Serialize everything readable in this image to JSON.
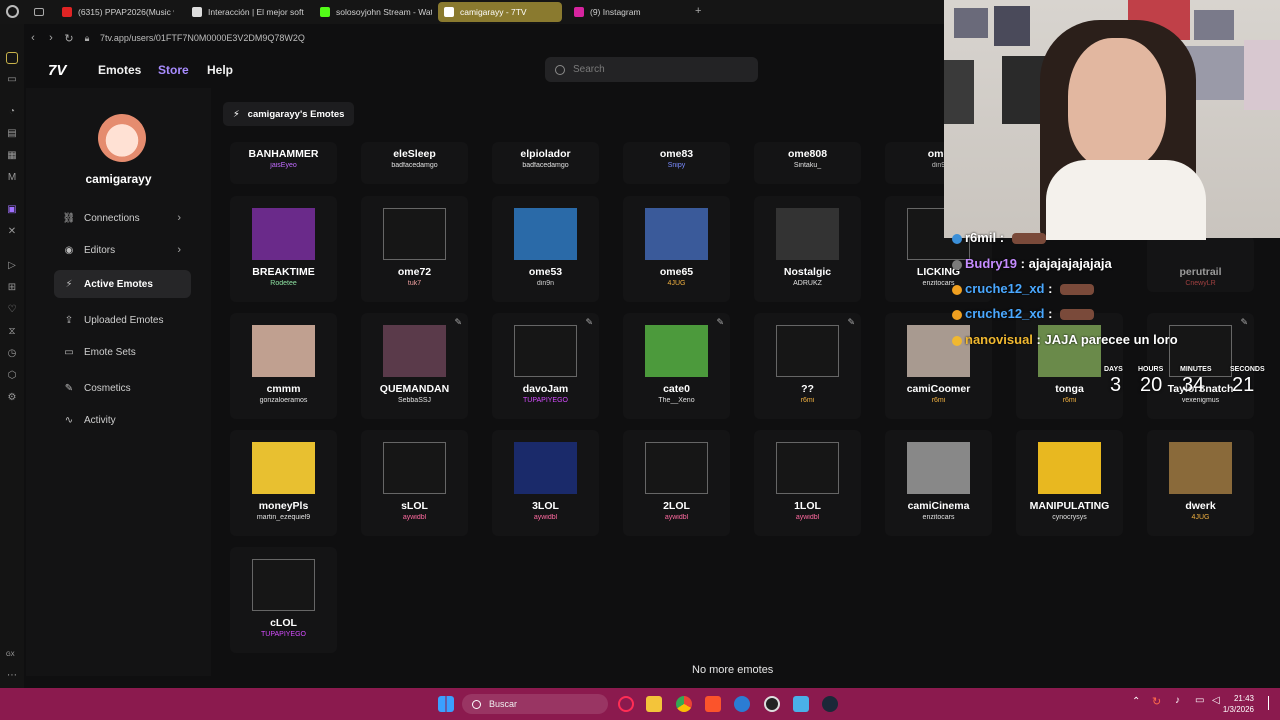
{
  "browser": {
    "tabs": [
      {
        "label": "(6315) PPAP2026(Music v",
        "color": "#e02424",
        "active": false
      },
      {
        "label": "Interacción | El mejor soft",
        "color": "#dddddd",
        "active": false
      },
      {
        "label": "solosoyjohn Stream - Wat",
        "color": "#53fc18",
        "active": false
      },
      {
        "label": "camigarayy - 7TV",
        "color": "#ffffff",
        "active": true
      },
      {
        "label": "(9) Instagram",
        "color": "#d6249f",
        "active": false
      }
    ],
    "url": "7tv.app/users/01FTF7N0M0000E3V2DM9Q78W2Q"
  },
  "header": {
    "logo": "7V",
    "nav": [
      "Emotes",
      "Store",
      "Help"
    ],
    "store_color": "#a88cff",
    "search_placeholder": "Search"
  },
  "sidebar": {
    "username": "camigarayy",
    "items": [
      {
        "label": "Connections",
        "icon": "link-icon",
        "glyph": "⛓",
        "chevron": true,
        "active": false
      },
      {
        "label": "Editors",
        "icon": "user-circle-icon",
        "glyph": "◉",
        "chevron": true,
        "active": false
      },
      {
        "label": "Active Emotes",
        "icon": "bolt-icon",
        "glyph": "⚡",
        "chevron": false,
        "active": true
      },
      {
        "label": "Uploaded Emotes",
        "icon": "upload-icon",
        "glyph": "⇪",
        "chevron": false,
        "active": false
      },
      {
        "label": "Emote Sets",
        "icon": "folder-icon",
        "glyph": "▭",
        "chevron": false,
        "active": false
      },
      {
        "label": "Cosmetics",
        "icon": "brush-icon",
        "glyph": "✎",
        "chevron": false,
        "active": false
      },
      {
        "label": "Activity",
        "icon": "activity-icon",
        "glyph": "∿",
        "chevron": false,
        "active": false
      }
    ]
  },
  "content": {
    "title": "camigarayy's Emotes",
    "footer": "No more emotes",
    "rows": [
      [
        {
          "name": "BANHAMMER",
          "owner": "jaisEyeo",
          "ownerColor": "#c26cff"
        },
        {
          "name": "eleSleep",
          "owner": "badfacedamgo",
          "ownerColor": "#e0e0e0"
        },
        {
          "name": "elpiolador",
          "owner": "badfacedamgo",
          "ownerColor": "#e0e0e0"
        },
        {
          "name": "ome83",
          "owner": "Snipy",
          "ownerColor": "#7a8cff"
        },
        {
          "name": "ome808",
          "owner": "Sintaku_",
          "ownerColor": "#e0e0e0"
        },
        {
          "name": "ome",
          "owner": "din9",
          "ownerColor": "#bbbbbb"
        }
      ],
      [
        {
          "name": "BREAKTIME",
          "owner": "Rodetee",
          "ownerColor": "#8ce0a0",
          "pic": "#6a2a8a"
        },
        {
          "name": "ome72",
          "owner": "tuk7",
          "ownerColor": "#f0a0a0"
        },
        {
          "name": "ome53",
          "owner": "din9n",
          "ownerColor": "#d0d0d0",
          "pic": "#2a6aa8"
        },
        {
          "name": "ome65",
          "owner": "4JUG",
          "ownerColor": "#f0b040",
          "pic": "#3a5a9a"
        },
        {
          "name": "Nostalgic",
          "owner": "ADRUKZ",
          "ownerColor": "#e0e0e0",
          "pic": "#333333"
        },
        {
          "name": "LICKING",
          "owner": "enzitocars",
          "ownerColor": "#e0e0e0"
        }
      ],
      [
        {
          "name": "cmmm",
          "owner": "gonzaloeramos",
          "ownerColor": "#e0e0e0",
          "pic": "#c0a090"
        },
        {
          "name": "QUEMANDAN",
          "owner": "SebbaSSJ",
          "ownerColor": "#e0e0e0",
          "pic": "#5a3a4a",
          "edit": true
        },
        {
          "name": "davoJam",
          "owner": "TUPAPIYEGO",
          "ownerColor": "#d54cff",
          "edit": true
        },
        {
          "name": "cate0",
          "owner": "The__Xeno",
          "ownerColor": "#e0e0e0",
          "pic": "#4c9a3c",
          "edit": true
        },
        {
          "name": "??",
          "owner": "r6mi",
          "ownerColor": "#f0b040",
          "edit": true
        },
        {
          "name": "camiCoomer",
          "owner": "r6mi",
          "ownerColor": "#f0b040",
          "pic": "#a89a90"
        },
        {
          "name": "tonga",
          "owner": "r6mi",
          "ownerColor": "#f0b040",
          "pic": "#6a8a4a"
        },
        {
          "name": "TaylorSnatch",
          "owner": "vexenigmus",
          "ownerColor": "#e0e0e0",
          "edit": true
        }
      ],
      [
        {
          "name": "moneyPls",
          "owner": "martin_ezequiel9",
          "ownerColor": "#e0e0e0",
          "pic": "#e8c030"
        },
        {
          "name": "sLOL",
          "owner": "aywidbl",
          "ownerColor": "#ff6aa0"
        },
        {
          "name": "3LOL",
          "owner": "aywidbl",
          "ownerColor": "#ff6aa0",
          "pic": "#1a2a6a"
        },
        {
          "name": "2LOL",
          "owner": "aywidbl",
          "ownerColor": "#ff6aa0"
        },
        {
          "name": "1LOL",
          "owner": "aywidbl",
          "ownerColor": "#ff6aa0"
        },
        {
          "name": "camiCinema",
          "owner": "enzitocars",
          "ownerColor": "#e0e0e0",
          "pic": "#888888"
        },
        {
          "name": "MANIPULATING",
          "owner": "cynocrysys",
          "ownerColor": "#e0e0e0",
          "pic": "#e8b820"
        },
        {
          "name": "dwerk",
          "owner": "4JUG",
          "ownerColor": "#f0b040",
          "pic": "#8a6a3a"
        }
      ],
      [
        {
          "name": "cLOL",
          "owner": "TUPAPIYEGO",
          "ownerColor": "#d54cff"
        }
      ]
    ]
  },
  "overlay": {
    "chat": [
      {
        "user": "r6mil",
        "userColor": "#ffffff",
        "message": "",
        "badge": "#3b8fd8"
      },
      {
        "user": "Budry19",
        "userColor": "#c58cff",
        "message": "ajajajajajajaja",
        "badge": "#7a7a7a"
      },
      {
        "user": "cruche12_xd",
        "userColor": "#4aa8ff",
        "message": "",
        "badge": "#f0a020"
      },
      {
        "user": "cruche12_xd",
        "userColor": "#4aa8ff",
        "message": "",
        "badge": "#f0a020"
      },
      {
        "user": "nanovisual",
        "userColor": "#f0b830",
        "message": "JAJA parecee un loro",
        "badge": "#f0b830"
      }
    ],
    "partial_name": "perutrail",
    "partial_owner": "CnewyLR",
    "countdown": [
      {
        "label": "DAYS",
        "value": "3"
      },
      {
        "label": "HOURS",
        "value": "20"
      },
      {
        "label": "MINUTES",
        "value": "34"
      },
      {
        "label": "SECONDS",
        "value": "21"
      }
    ]
  },
  "taskbar": {
    "search_label": "Buscar",
    "time": "21:43",
    "date": "1/3/2026",
    "gx_label": "GX"
  }
}
